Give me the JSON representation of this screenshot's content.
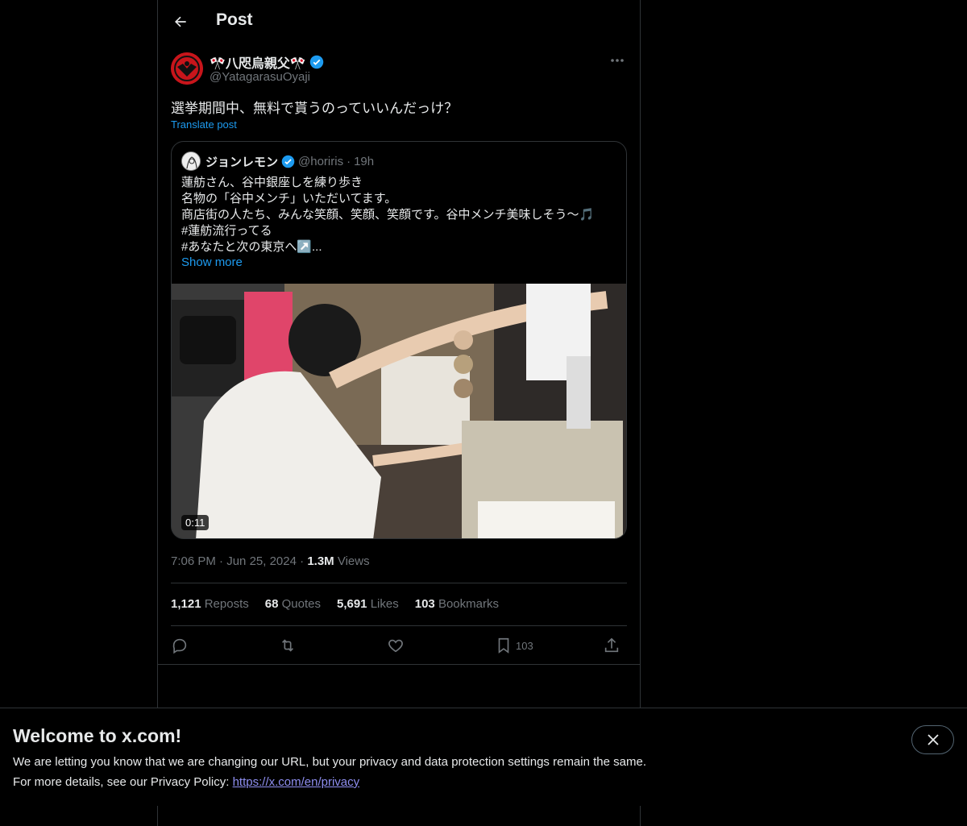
{
  "header": {
    "title": "Post"
  },
  "author": {
    "name": "🎌八咫烏親父🎌",
    "handle": "@YatagarasuOyaji"
  },
  "post": {
    "text": "選挙期間中、無料で貰うのっていいんだっけ？",
    "translate_label": "Translate post"
  },
  "quote": {
    "name": "ジョンレモン",
    "handle": "@horiris",
    "dot": "·",
    "time": "19h",
    "lines": [
      "蓮舫さん、谷中銀座しを練り歩き",
      "名物の「谷中メンチ」いただいてます。",
      "商店街の人たち、みんな笑顔、笑顔、笑顔です。谷中メンチ美味しそう〜🎵",
      "#蓮舫流行ってる",
      "#あなたと次の東京へ↗️..."
    ],
    "show_more": "Show more",
    "duration": "0:11"
  },
  "meta": {
    "time": "7:06 PM",
    "dot": "·",
    "date": "Jun 25, 2024",
    "views_count": "1.3M",
    "views_label": "Views"
  },
  "stats": {
    "reposts_count": "1,121",
    "reposts_label": "Reposts",
    "quotes_count": "68",
    "quotes_label": "Quotes",
    "likes_count": "5,691",
    "likes_label": "Likes",
    "bookmarks_count": "103",
    "bookmarks_label": "Bookmarks"
  },
  "actions": {
    "bookmark_count": "103"
  },
  "banner": {
    "title": "Welcome to x.com!",
    "line1": "We are letting you know that we are changing our URL, but your privacy and data protection settings remain the same.",
    "line2_prefix": "For more details, see our Privacy Policy: ",
    "link": "https://x.com/en/privacy"
  },
  "colors": {
    "background": "#000000",
    "accent": "#1d9bf0",
    "verified": "#1d9bf0",
    "muted": "#71767b",
    "border": "#2f3336"
  }
}
